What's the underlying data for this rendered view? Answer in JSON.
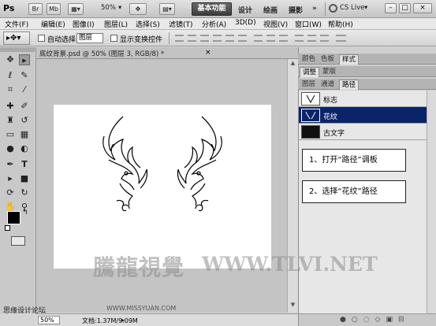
{
  "app": {
    "logo": "Ps"
  },
  "appbar": {
    "zoom": "50%",
    "workspaces": [
      "基本功能",
      "设计",
      "绘画",
      "摄影"
    ],
    "more": "»",
    "cs_live": "CS Live",
    "win_buttons": [
      "–",
      "□",
      "×"
    ]
  },
  "menu": [
    "文件(F)",
    "编辑(E)",
    "图像(I)",
    "图层(L)",
    "选择(S)",
    "滤镜(T)",
    "分析(A)",
    "3D(D)",
    "视图(V)",
    "窗口(W)",
    "帮助(H)"
  ],
  "options": {
    "auto_select_label": "自动选择:",
    "auto_select_value": "图层",
    "show_transform_label": "显示变换控件"
  },
  "document": {
    "tab_title": "底纹背景.psd @ 50% (图层 3, RGB/8) *",
    "close": "×"
  },
  "status": {
    "zoom": "50%",
    "doc_info": "文档:1.37M/9.09M"
  },
  "panels": {
    "group1_tabs": [
      "颜色",
      "色板",
      "样式"
    ],
    "group2_tabs": [
      "调整",
      "蒙版"
    ],
    "group3_tabs": [
      "图层",
      "通道",
      "路径"
    ],
    "paths": [
      {
        "name": "标志",
        "selected": false
      },
      {
        "name": "花纹",
        "selected": true
      },
      {
        "name": "古文字",
        "selected": false
      }
    ]
  },
  "callouts": [
    "1、打开“路径”调板",
    "2、选择“花纹”路径"
  ],
  "watermark": {
    "cn": "騰龍視覺",
    "url": "WWW.TLVI.NET",
    "footer_left": "思缘设计论坛",
    "footer_mid": "WWW.MISSYUAN.COM"
  },
  "colors": {
    "selection": "#0a246a",
    "canvas_bg": "#c4c4c4"
  }
}
